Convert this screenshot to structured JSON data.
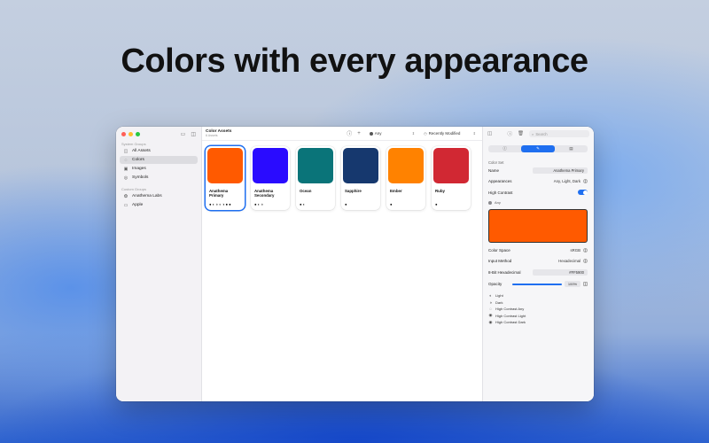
{
  "headline": "Colors with every appearance",
  "sidebar": {
    "section_system": "System Groups",
    "items": [
      {
        "label": "All Assets",
        "icon": "◫"
      },
      {
        "label": "Colors",
        "icon": "◌"
      },
      {
        "label": "Images",
        "icon": "▣"
      },
      {
        "label": "Symbols",
        "icon": "◎"
      }
    ],
    "section_custom": "Custom Groups",
    "custom_items": [
      {
        "label": "Anathema Labs",
        "icon": "❂"
      },
      {
        "label": "Apple",
        "icon": "▭"
      }
    ]
  },
  "toolbar": {
    "title": "Color Assets",
    "subtitle": "6 Assets",
    "info_icon": "ⓘ",
    "add_icon": "+",
    "appearance_filter": "Any",
    "sort": "Recently Modified"
  },
  "cards": [
    {
      "name": "Anathema Primary",
      "color": "#ff5a00",
      "apps": "● ◐ ◑ ◐ ◑ ● ●"
    },
    {
      "name": "Anathema Secondary",
      "color": "#2a0bff",
      "apps": "● ◐ ◑"
    },
    {
      "name": "Ocean",
      "color": "#0a7479",
      "apps": "● ◐"
    },
    {
      "name": "Sapphire",
      "color": "#16386e",
      "apps": "●"
    },
    {
      "name": "Ember",
      "color": "#ff8200",
      "apps": "●"
    },
    {
      "name": "Ruby",
      "color": "#d12833",
      "apps": "●"
    }
  ],
  "inspector": {
    "search_placeholder": "Search",
    "tabs": [
      "ⓘ",
      "✎",
      "▤"
    ],
    "section_label": "Color Set",
    "name_label": "Name",
    "name_value": "Anathema Primary",
    "appearances_label": "Appearances",
    "appearances_value": "Any, Light, Dark",
    "high_contrast_label": "High Contrast",
    "high_contrast_on": true,
    "variant_label": "Any",
    "preview_color": "#ff5a00",
    "color_space_label": "Color Space",
    "color_space_value": "sRGB",
    "input_method_label": "Input Method",
    "input_method_value": "Hexadecimal",
    "hex_label": "8-Bit Hexadecimal",
    "hex_value": "#FF5900",
    "opacity_label": "Opacity",
    "opacity_value": "100%",
    "opacity_fraction": 1.0,
    "appearance_list": [
      {
        "label": "Light",
        "icon": "◐"
      },
      {
        "label": "Dark",
        "icon": "◑"
      },
      {
        "label": "High Contrast Any",
        "icon": "◌"
      },
      {
        "label": "High Contrast Light",
        "icon": "◉"
      },
      {
        "label": "High Contrast Dark",
        "icon": "◉"
      }
    ]
  },
  "colors": {
    "accent": "#1f6ff0"
  }
}
